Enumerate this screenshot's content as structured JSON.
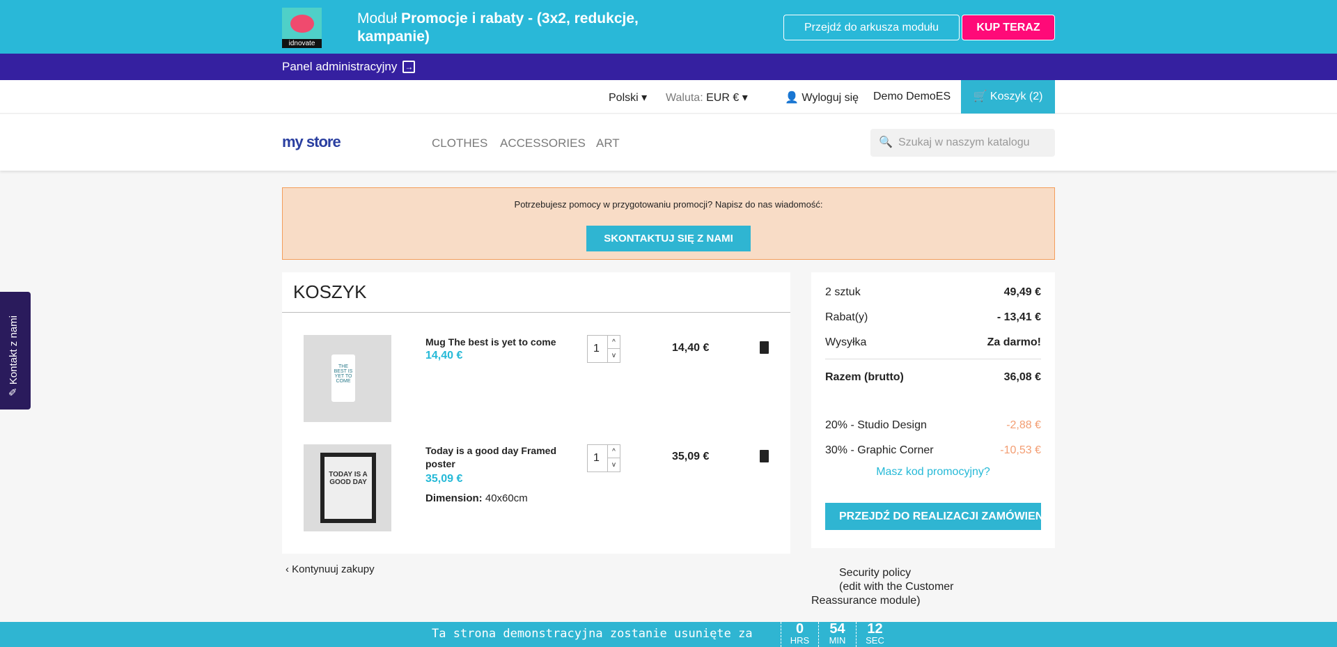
{
  "banner": {
    "logo_text": "idnovate",
    "title_prefix": "Moduł ",
    "title_bold": "Promocje i rabaty - (3x2, redukcje, kampanie)",
    "sheet_button": "Przejdź do arkusza modułu",
    "buy_button": "KUP TERAZ"
  },
  "admin": {
    "label": "Panel administracyjny"
  },
  "usernav": {
    "language": "Polski",
    "currency_label": "Waluta:",
    "currency": "EUR €",
    "logout": "Wyloguj się",
    "customer": "Demo DemoES",
    "cart": "Koszyk (2)"
  },
  "header": {
    "logo": "my store",
    "menu": [
      "CLOTHES",
      "ACCESSORIES",
      "ART"
    ],
    "search_placeholder": "Szukaj w naszym katalogu"
  },
  "alert": {
    "text": "Potrzebujesz pomocy w przygotowaniu promocji? Napisz do nas wiadomość:",
    "button": "SKONTAKTUJ SIĘ Z NAMI"
  },
  "cart": {
    "title": "KOSZYK",
    "items": [
      {
        "name": "Mug The best is yet to come",
        "price": "14,40 €",
        "qty": "1",
        "total": "14,40 €",
        "image_text": "THE BEST IS YET TO COME"
      },
      {
        "name": "Today is a good day Framed poster",
        "price": "35,09 €",
        "qty": "1",
        "total": "35,09 €",
        "attr_label": "Dimension:",
        "attr_value": "40x60cm",
        "image_text": "TODAY IS A GOOD DAY"
      }
    ],
    "continue": "Kontynuuj zakupy"
  },
  "summary": {
    "items_label": "2 sztuk",
    "items_value": "49,49 €",
    "discount_label": "Rabat(y)",
    "discount_value": "- 13,41 €",
    "shipping_label": "Wysyłka",
    "shipping_value": "Za darmo!",
    "total_label": "Razem (brutto)",
    "total_value": "36,08 €",
    "rules": [
      {
        "label": "20% - Studio Design",
        "value": "-2,88 €"
      },
      {
        "label": "30% - Graphic Corner",
        "value": "-10,53 €"
      }
    ],
    "promo_link": "Masz kod promocyjny?",
    "checkout": "PRZEJDŹ DO REALIZACJI ZAMÓWIENIA"
  },
  "reassurance": {
    "line1": "Security policy",
    "line2": "(edit with the Customer Reassurance module)"
  },
  "contact_tab": "Kontakt z nami",
  "demo": {
    "text": "Ta strona demonstracyjna zostanie usunięte za",
    "hours": "0",
    "hours_label": "HRS",
    "minutes": "54",
    "minutes_label": "MIN",
    "seconds": "12",
    "seconds_label": "SEC"
  },
  "colors": {
    "primary": "#2fb5d2",
    "admin_bar": "#3520a0",
    "buy": "#ff0a78",
    "alert_bg": "#f8dcc6",
    "discount": "#f39d72"
  }
}
